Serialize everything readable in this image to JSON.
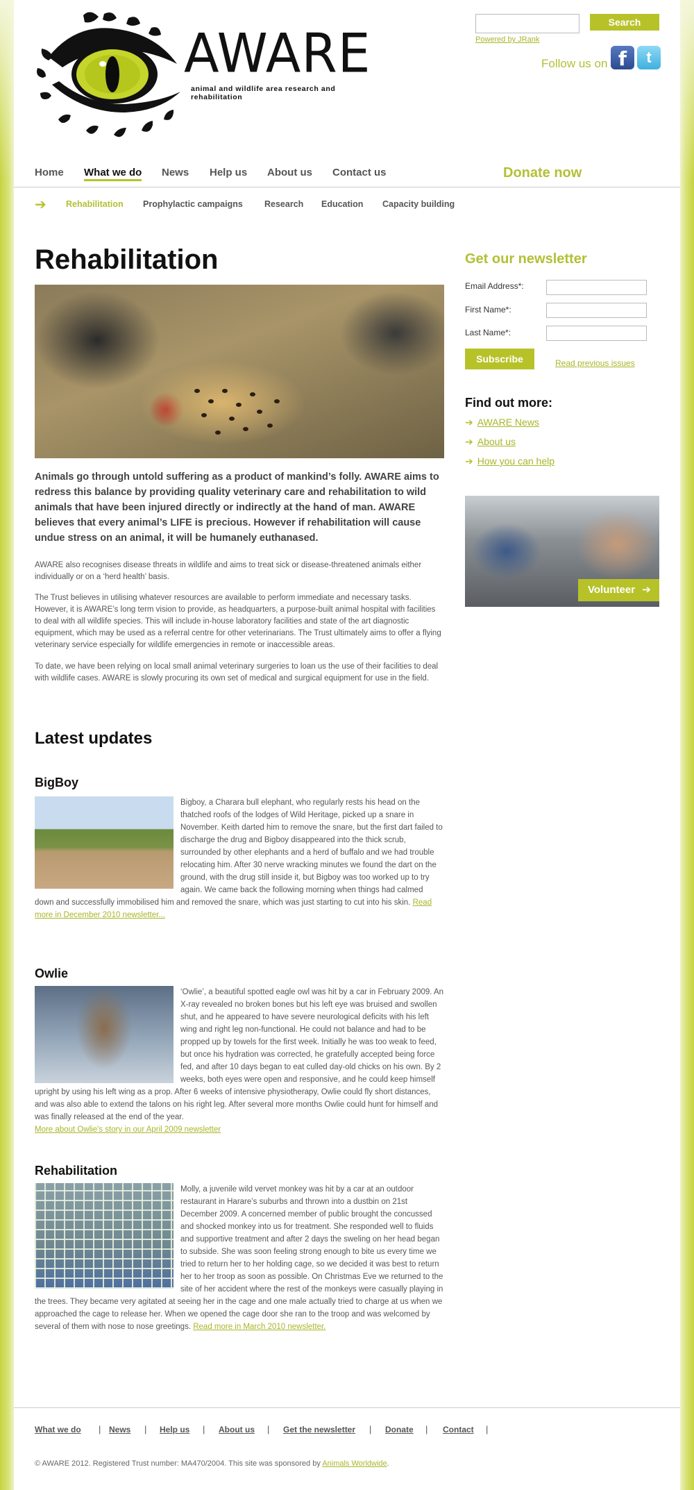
{
  "header": {
    "logo_word": "AWARE",
    "logo_tagline": "animal and wildlife area research and rehabilitation",
    "search_button": "Search",
    "powered_by": "Powered by JRank",
    "follow_label": "Follow us on",
    "facebook_glyph": "f",
    "twitter_glyph": "t"
  },
  "nav": {
    "items": [
      "Home",
      "What we do",
      "News",
      "Help us",
      "About us",
      "Contact us"
    ],
    "active": "What we do",
    "donate": "Donate now"
  },
  "subnav": {
    "items": [
      "Rehabilitation",
      "Prophylactic campaigns",
      "Research",
      "Education",
      "Capacity building"
    ],
    "active": "Rehabilitation"
  },
  "main": {
    "title": "Rehabilitation",
    "intro": "Animals go through untold suffering as a product of mankind’s folly. AWARE aims to redress this balance by providing quality veterinary care and rehabilitation to wild animals that have been injured directly or indirectly at the hand of man. AWARE believes that every animal’s LIFE is precious. However if rehabilitation will cause undue stress on an animal, it will be humanely euthanased.",
    "paragraphs": [
      "AWARE also recognises disease threats in wildlife and aims to treat sick or disease-threatened animals either individually or on a ‘herd health’ basis.",
      "The Trust believes in utilising whatever resources are available to perform immediate and necessary tasks. However, it is AWARE’s long term vision to provide, as headquarters, a purpose-built animal hospital with facilities to deal with all wildlife species. This will include in-house laboratory facilities and state of the art diagnostic equipment, which may be used as a referral centre for other veterinarians. The Trust ultimately aims to offer a flying veterinary service especially for wildlife emergencies in remote or inaccessible areas.",
      "To date, we have been relying on local small animal veterinary surgeries to loan us the use of their facilities to deal with wildlife cases. AWARE is slowly procuring its own set of medical and surgical equipment for use in the field."
    ],
    "latest_title": "Latest updates",
    "updates": [
      {
        "title": "BigBoy",
        "text": "Bigboy, a Charara bull elephant, who regularly rests his head on the thatched roofs of the lodges of Wild Heritage, picked up a snare in November. Keith darted him to remove the snare, but the first dart failed to discharge the drug and Bigboy disappeared into the thick scrub, surrounded by other elephants and a herd of buffalo and we had trouble relocating him. After 30 nerve wracking minutes we found the dart on the ground, with the drug still inside it, but Bigboy was too worked up to try again. We came back the following morning when things had calmed down and successfully immobilised him and removed the snare, which was just starting to cut into his skin.",
        "link": "Read more in December 2010 newsletter..."
      },
      {
        "title": "Owlie",
        "text": "‘Owlie’, a beautiful spotted eagle owl was hit by a car in February 2009.  An X-ray revealed no broken bones but his left eye was bruised and swollen shut, and he appeared to have severe neurological deficits with his left wing and right leg non-functional. He could not balance and had to be propped up by towels for the first week. Initially he was too weak to feed, but once his hydration was corrected, he gratefully accepted being force fed, and after 10 days began to eat culled day-old chicks on his own. By 2 weeks, both eyes were open and responsive, and he could keep himself upright by using his left wing as a prop.  After 6 weeks of intensive physiotherapy, Owlie could fly short distances, and was also able to extend the talons on his right leg. After several more months Owlie could hunt for himself and was finally released at the end of the year.",
        "link": "More about Owlie's story in our April 2009 newsletter"
      },
      {
        "title": "Rehabilitation",
        "text": "Molly, a juvenile wild vervet monkey was hit by a car at an outdoor restaurant in Harare’s suburbs and thrown into a dustbin on 21st December 2009. A concerned member of public brought the concussed and shocked monkey into us for treatment. She responded well to fluids and supportive treatment and after 2 days the sweling on her head began to subside. She was soon feeling strong enough to bite us every time we tried to return her to her holding cage, so we decided it was best to return her to her troop as soon as possible. On Christmas Eve we returned to the site of her accident where the rest of the monkeys were casually playing in the trees.  They became very agitated at seeing her in the cage and one male actually tried to charge at us when we approached the cage to release her. When we opened the cage door she ran to the troop and was welcomed by several of them with nose to nose greetings.",
        "link": "Read more in March 2010 newsletter."
      }
    ]
  },
  "sidebar": {
    "newsletter_title": "Get our newsletter",
    "fields": [
      "Email Address*:",
      "First Name*:",
      "Last Name*:"
    ],
    "subscribe": "Subscribe",
    "read_previous": "Read previous issues",
    "find_out_title": "Find out more:",
    "links": [
      "AWARE News",
      "About us",
      "How you can help"
    ],
    "volunteer": "Volunteer"
  },
  "footer": {
    "links": [
      "What we do",
      "News",
      "Help us",
      "About us",
      "Get the newsletter",
      "Donate",
      "Contact"
    ],
    "separator": "|",
    "copyright": "© AWARE 2012. Registered Trust number: MA470/2004. This site was sponsored by",
    "sponsor": "Animals Worldwide",
    "copyright_end": "."
  },
  "colors": {
    "accent": "#b7c229",
    "accent_text": "#b3c035"
  }
}
